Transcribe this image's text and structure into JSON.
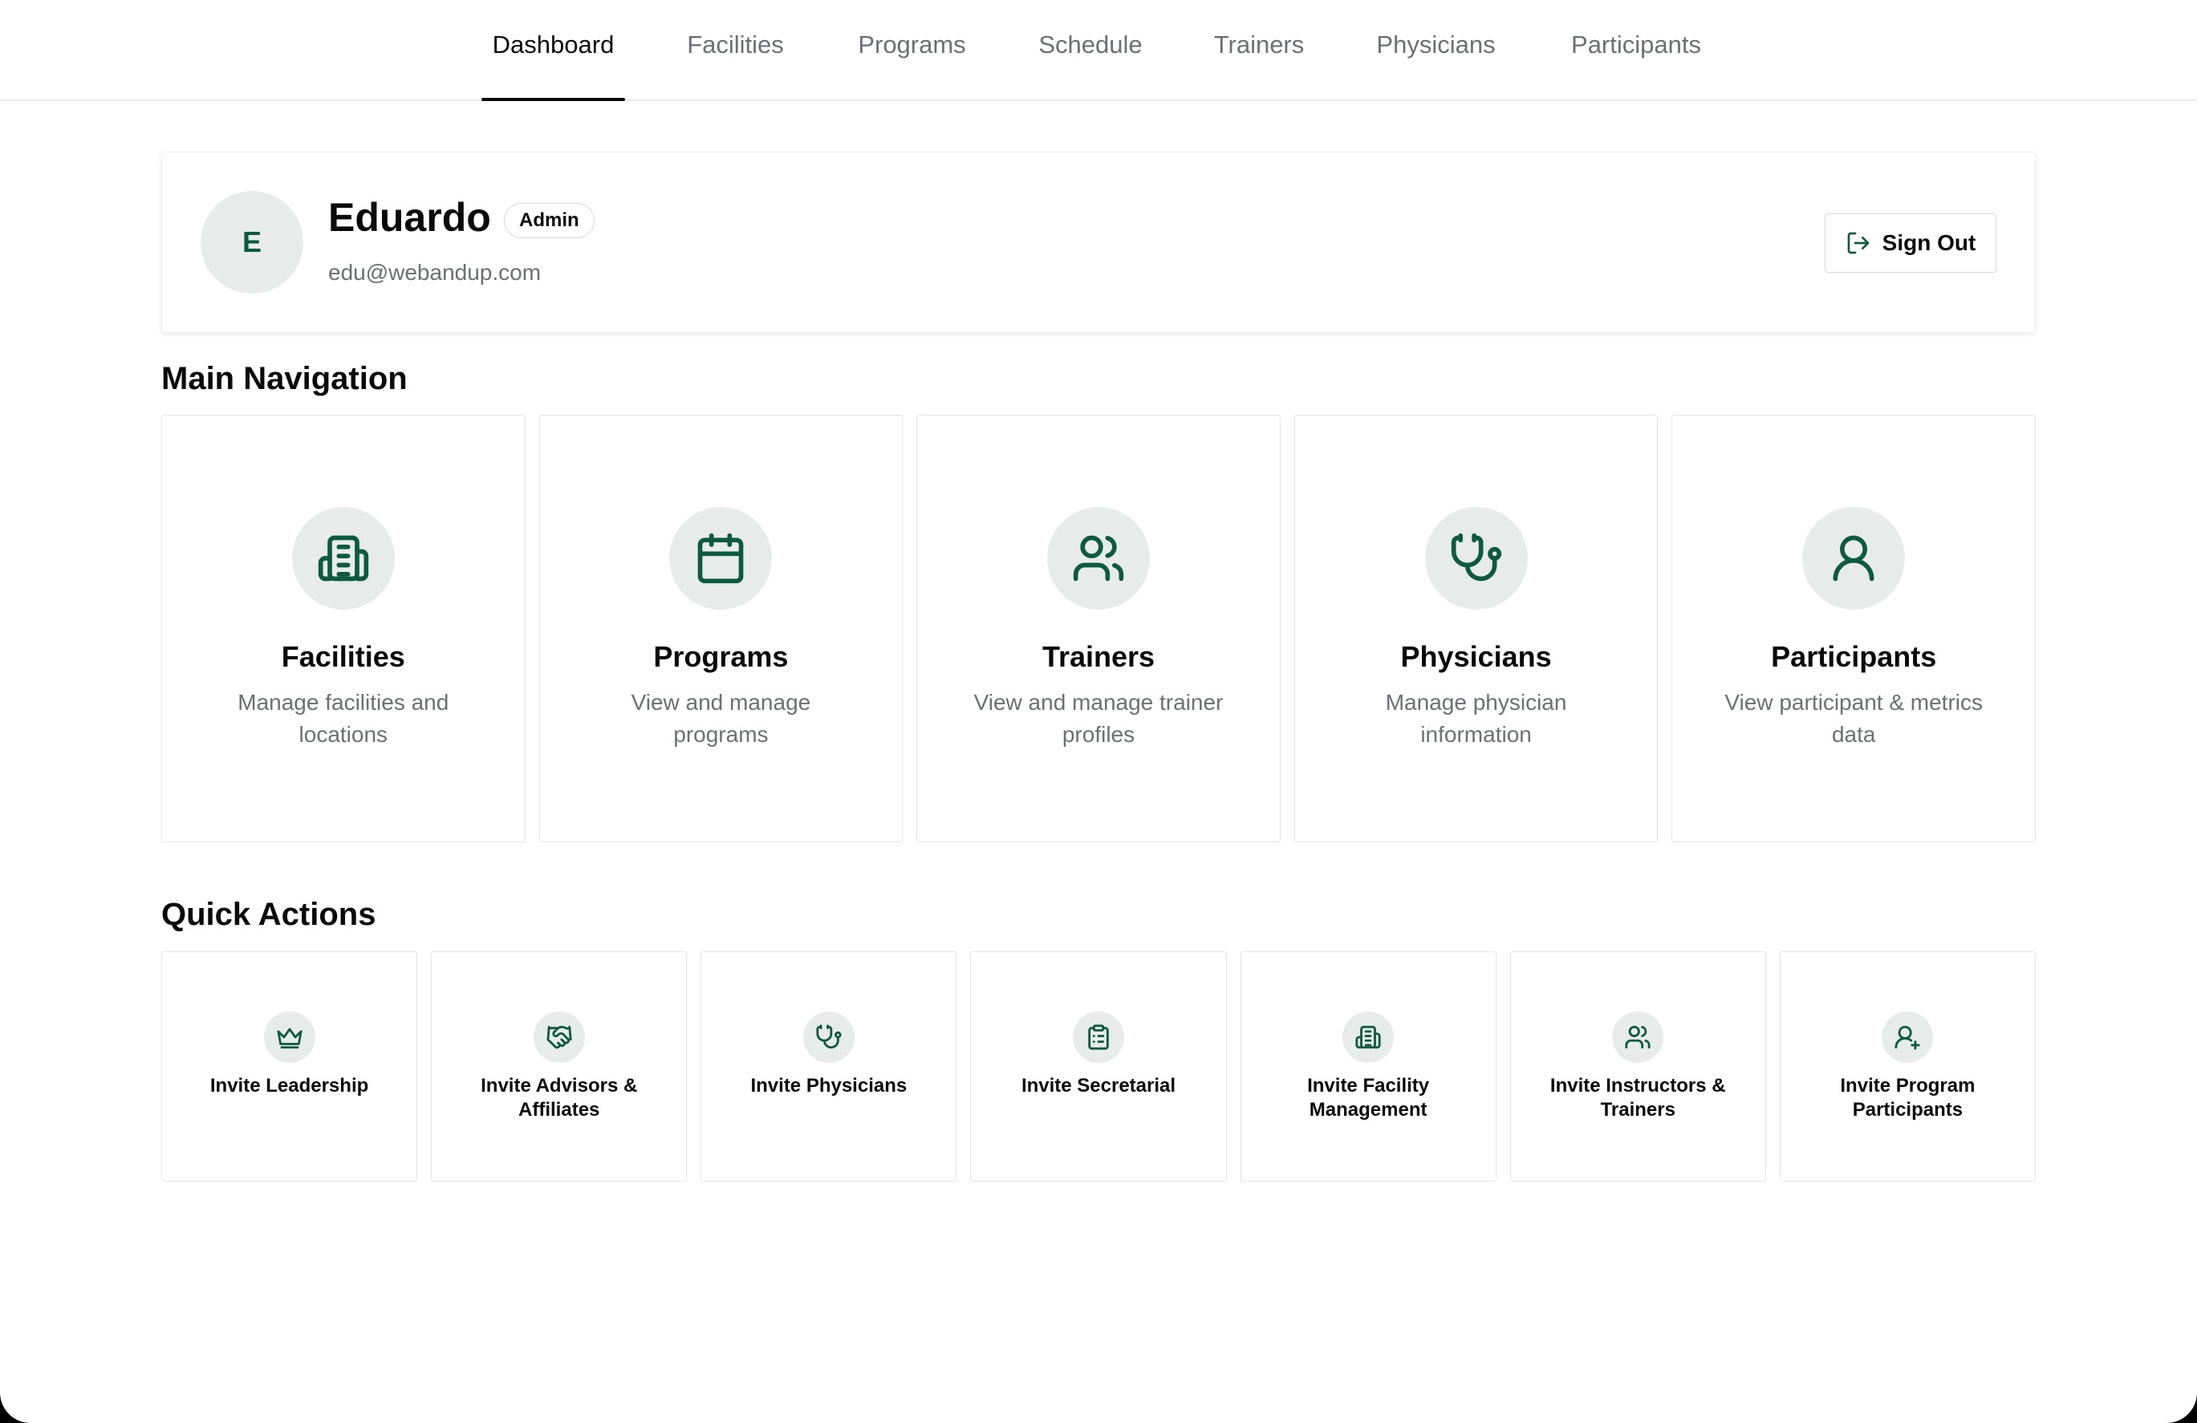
{
  "nav": {
    "tabs": [
      {
        "label": "Dashboard",
        "active": true
      },
      {
        "label": "Facilities"
      },
      {
        "label": "Programs"
      },
      {
        "label": "Schedule"
      },
      {
        "label": "Trainers"
      },
      {
        "label": "Physicians"
      },
      {
        "label": "Participants"
      }
    ]
  },
  "profile": {
    "initial": "E",
    "name": "Eduardo",
    "role": "Admin",
    "email": "edu@webandup.com",
    "signout_label": "Sign Out"
  },
  "main_navigation": {
    "title": "Main Navigation",
    "cards": [
      {
        "icon": "building-icon",
        "title": "Facilities",
        "description": "Manage facilities and locations"
      },
      {
        "icon": "calendar-icon",
        "title": "Programs",
        "description": "View and manage programs"
      },
      {
        "icon": "users-icon",
        "title": "Trainers",
        "description": "View and manage trainer profiles"
      },
      {
        "icon": "stethoscope-icon",
        "title": "Physicians",
        "description": "Manage physician information"
      },
      {
        "icon": "user-icon",
        "title": "Participants",
        "description": "View participant & metrics data"
      }
    ]
  },
  "quick_actions": {
    "title": "Quick Actions",
    "items": [
      {
        "icon": "crown-icon",
        "label": "Invite Leadership"
      },
      {
        "icon": "handshake-icon",
        "label": "Invite Advisors & Affiliates"
      },
      {
        "icon": "stethoscope-icon",
        "label": "Invite Physicians"
      },
      {
        "icon": "clipboard-icon",
        "label": "Invite Secretarial"
      },
      {
        "icon": "building-icon",
        "label": "Invite Facility Management"
      },
      {
        "icon": "users-icon",
        "label": "Invite Instructors & Trainers"
      },
      {
        "icon": "user-plus-icon",
        "label": "Invite Program Participants"
      }
    ]
  },
  "colors": {
    "accent": "#0e5a41",
    "icon_bg": "#e7ecea",
    "muted_text": "#6b6f76",
    "border": "#e2e4e7"
  }
}
